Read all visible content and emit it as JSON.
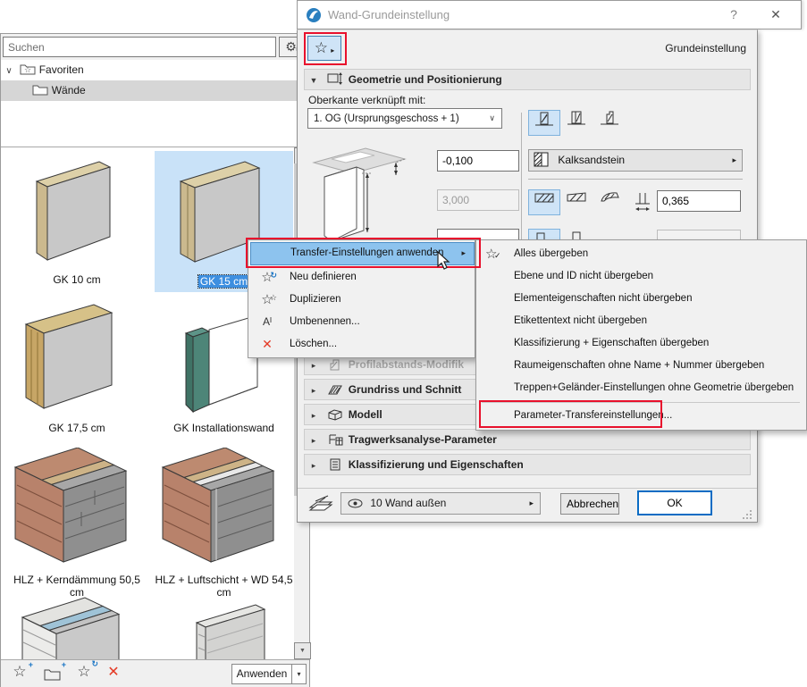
{
  "icons": {
    "gear": "⚙",
    "menu_arrow": "▸",
    "chevron_down": "∨",
    "scroll_up": "▲",
    "scroll_down": "▼",
    "star": "☆",
    "check": "✓",
    "delete_x": "✕",
    "plus": "+",
    "refresh": "↻",
    "rename": "Aᴵ",
    "dropdown": "▾"
  },
  "left_panel": {
    "search_placeholder": "Suchen",
    "tree": {
      "root_label": "Favoriten",
      "folder_label": "Wände"
    },
    "walls": [
      {
        "label": "GK 10 cm",
        "selected": false
      },
      {
        "label": "GK 15 cm",
        "selected": true
      },
      {
        "label": "GK 17,5 cm",
        "selected": false
      },
      {
        "label": "GK Installationswand",
        "selected": false
      },
      {
        "label": "HLZ + Kerndämmung 50,5 cm",
        "selected": false
      },
      {
        "label": "HLZ + Luftschicht + WD 54,5 cm",
        "selected": false
      }
    ],
    "apply_label": "Anwenden"
  },
  "dialog": {
    "title": "Wand-Grundeinstellung",
    "help": "?",
    "close": "✕",
    "mode_label": "Grundeinstellung",
    "geometry_header": "Geometrie und Positionierung",
    "top_link_label": "Oberkante verknüpft mit:",
    "top_link_value": "1. OG (Ursprungsgeschoss + 1)",
    "offset_value": "-0,100",
    "height_value": "3,000",
    "material_value": "Kalksandstein",
    "thickness_value": "0,365",
    "rows": [
      {
        "label": "Profilabstands-Modifik"
      },
      {
        "label": "Grundriss und Schnitt"
      },
      {
        "label": "Modell"
      },
      {
        "label": "Tragwerksanalyse-Parameter"
      },
      {
        "label": "Klassifizierung und Eigenschaften"
      }
    ],
    "layer_value": "10 Wand außen",
    "cancel_label": "Abbrechen",
    "ok_label": "OK"
  },
  "context_menu": {
    "items": [
      {
        "label": "Transfer-Einstellungen anwenden"
      },
      {
        "label": "Neu definieren"
      },
      {
        "label": "Duplizieren"
      },
      {
        "label": "Umbenennen..."
      },
      {
        "label": "Löschen..."
      }
    ]
  },
  "submenu": {
    "items": [
      {
        "label": "Alles übergeben"
      },
      {
        "label": "Ebene und ID nicht übergeben"
      },
      {
        "label": "Elementeigenschaften nicht übergeben"
      },
      {
        "label": "Etikettentext nicht übergeben"
      },
      {
        "label": "Klassifizierung + Eigenschaften übergeben"
      },
      {
        "label": "Raumeigenschaften ohne Name + Nummer übergeben"
      },
      {
        "label": "Treppen+Geländer-Einstellungen ohne Geometrie übergeben"
      },
      {
        "label": "Parameter-Transfereinstellungen..."
      }
    ]
  }
}
